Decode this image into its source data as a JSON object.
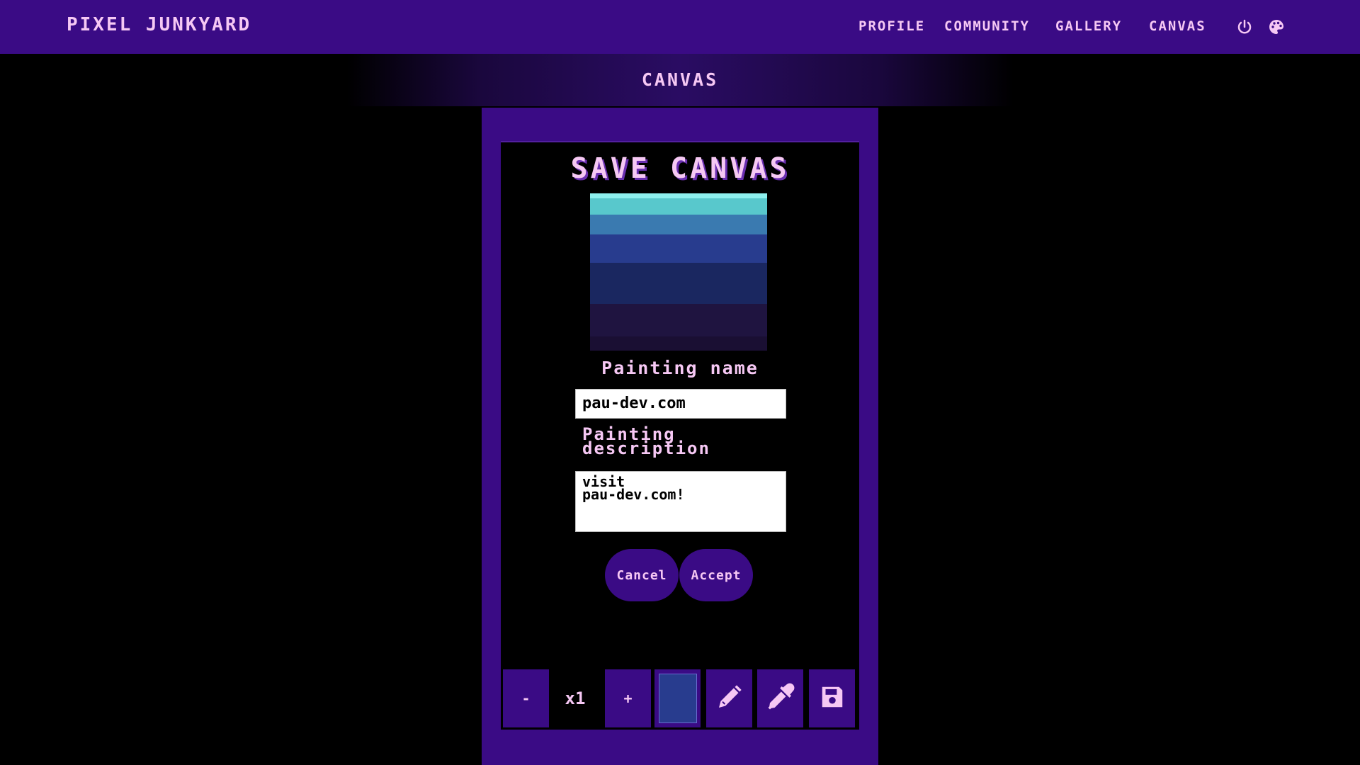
{
  "header": {
    "logo": "PIXEL JUNKYARD",
    "nav": [
      "PROFILE",
      "COMMUNITY",
      "GALLERY",
      "CANVAS"
    ],
    "icons": [
      "power-icon",
      "palette-icon"
    ]
  },
  "subheader": {
    "title": "CANVAS"
  },
  "dialog": {
    "title": "SAVE CANVAS",
    "preview_colors": [
      "#8ef0ee",
      "#58c8cc",
      "#3a7ab0",
      "#283c8e",
      "#1a2760",
      "#1f1440",
      "#1a0f33"
    ],
    "name_label": "Painting name",
    "name_value": "pau-dev.com",
    "desc_label": "Painting description",
    "desc_value": "visit\npau-dev.com!",
    "cancel_label": "Cancel",
    "accept_label": "Accept"
  },
  "toolbar": {
    "zoom_out_label": "-",
    "zoom_level": "x1",
    "zoom_in_label": "+",
    "current_color": "#283c8e",
    "tools": [
      "pencil-icon",
      "eyedropper-icon",
      "save-icon"
    ]
  },
  "colors": {
    "primary": "#3a0b85",
    "text": "#f6c8f4",
    "background": "#000000"
  }
}
